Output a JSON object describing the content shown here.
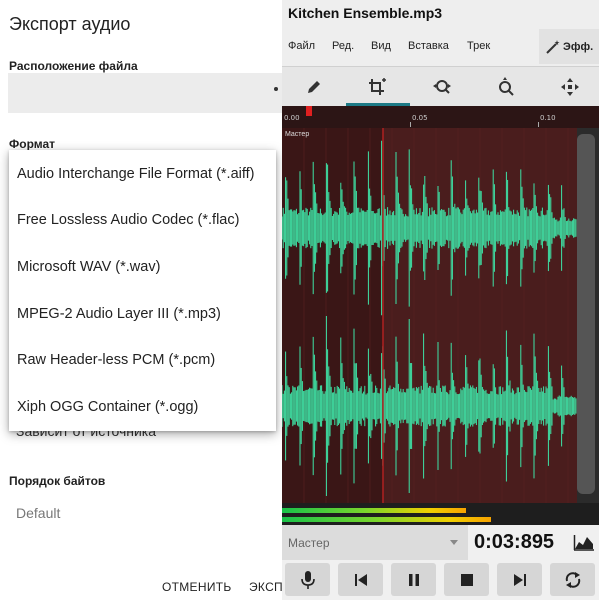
{
  "dialog": {
    "title": "Экспорт аудио",
    "location_label": "Расположение файла",
    "format_label": "Формат",
    "behind_text": "Зависит от источника",
    "byte_order_label": "Порядок байтов",
    "byte_order_value": "Default",
    "cancel_label": "ОТМЕНИТЬ",
    "export_label": "ЭКСП"
  },
  "format_options": [
    "Audio Interchange File Format (*.aiff)",
    "Free Lossless Audio Codec (*.flac)",
    "Microsoft WAV (*.wav)",
    "MPEG-2 Audio Layer III (*.mp3)",
    "Raw Header-less PCM (*.pcm)",
    "Xiph OGG Container (*.ogg)"
  ],
  "editor": {
    "title": "Kitchen Ensemble.mp3",
    "menu": [
      "Файл",
      "Ред.",
      "Вид",
      "Вставка",
      "Трек"
    ],
    "effects_label": "Эфф.",
    "tools": [
      "pencil-icon",
      "crop-add-icon",
      "zoom-fit-icon",
      "zoom-out-icon",
      "move-icon"
    ],
    "active_tool_index": 1,
    "timeline_labels": [
      "0.00",
      "0.05",
      "0.10"
    ],
    "track_tag": "Мастер",
    "track_select_value": "Мастер",
    "time": "0:03:895",
    "meter_levels": [
      0.58,
      0.66
    ],
    "transport": [
      "mic-icon",
      "skip-back-icon",
      "pause-icon",
      "stop-icon",
      "skip-forward-icon",
      "loop-icon"
    ],
    "colors": {
      "wave": "#3ee3a6",
      "wave_bg": "#3a1616",
      "selection_bg": "#4a1d1d",
      "accent": "#1d7a86"
    }
  }
}
